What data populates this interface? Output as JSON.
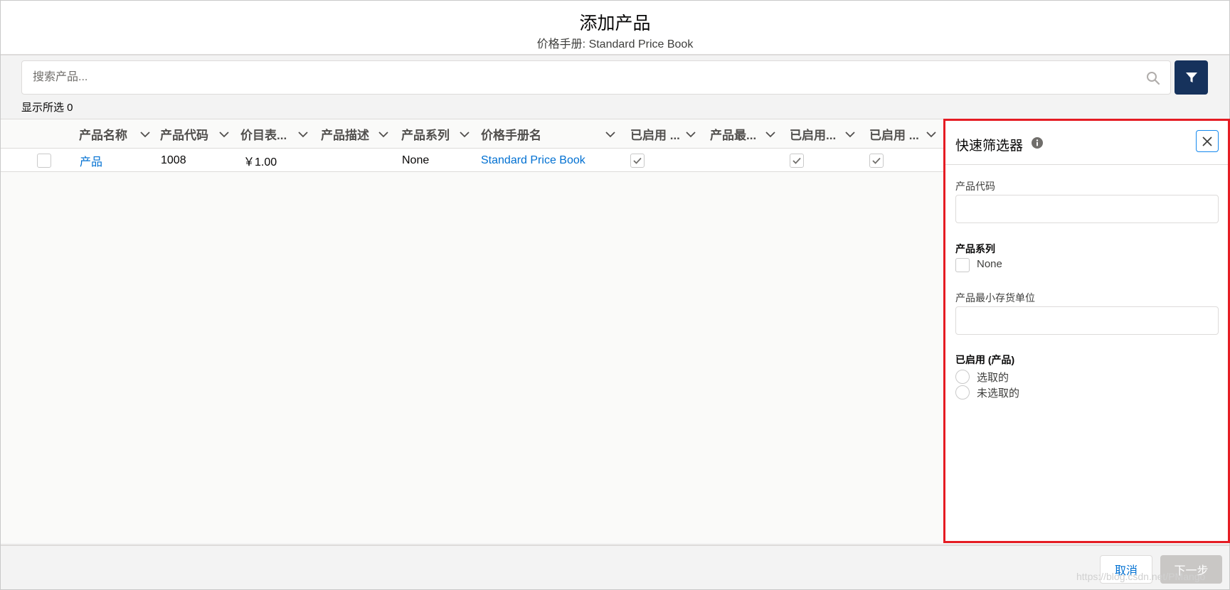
{
  "header": {
    "title": "添加产品",
    "subtitle": "价格手册: Standard Price Book"
  },
  "search": {
    "placeholder": "搜索产品...",
    "value": ""
  },
  "show_selected": "显示所选 0",
  "table": {
    "columns": [
      "产品名称",
      "产品代码",
      "价目表...",
      "产品描述",
      "产品系列",
      "价格手册名",
      "已启用 ...",
      "产品最...",
      "已启用...",
      "已启用 ..."
    ],
    "rows": [
      {
        "selected": false,
        "name": "产品",
        "code": "1008",
        "price": "￥1.00",
        "description": "",
        "family": "None",
        "pricebook": "Standard Price Book",
        "active1": true,
        "min_sku": "",
        "active2": true,
        "active3": true
      }
    ]
  },
  "filter_panel": {
    "title": "快速筛选器",
    "product_code_label": "产品代码",
    "product_code_value": "",
    "family_label": "产品系列",
    "family_option": "None",
    "min_sku_label": "产品最小存货单位",
    "min_sku_value": "",
    "active_label": "已启用 (产品)",
    "active_option_selected": "选取的",
    "active_option_unselected": "未选取的"
  },
  "footer": {
    "cancel_label": "取消",
    "next_label": "下一步"
  },
  "watermark": "https://blog.csdn.net/PMango",
  "colors": {
    "brand_dark": "#16325c",
    "link": "#0070d2",
    "highlight_border": "#e51c23"
  }
}
